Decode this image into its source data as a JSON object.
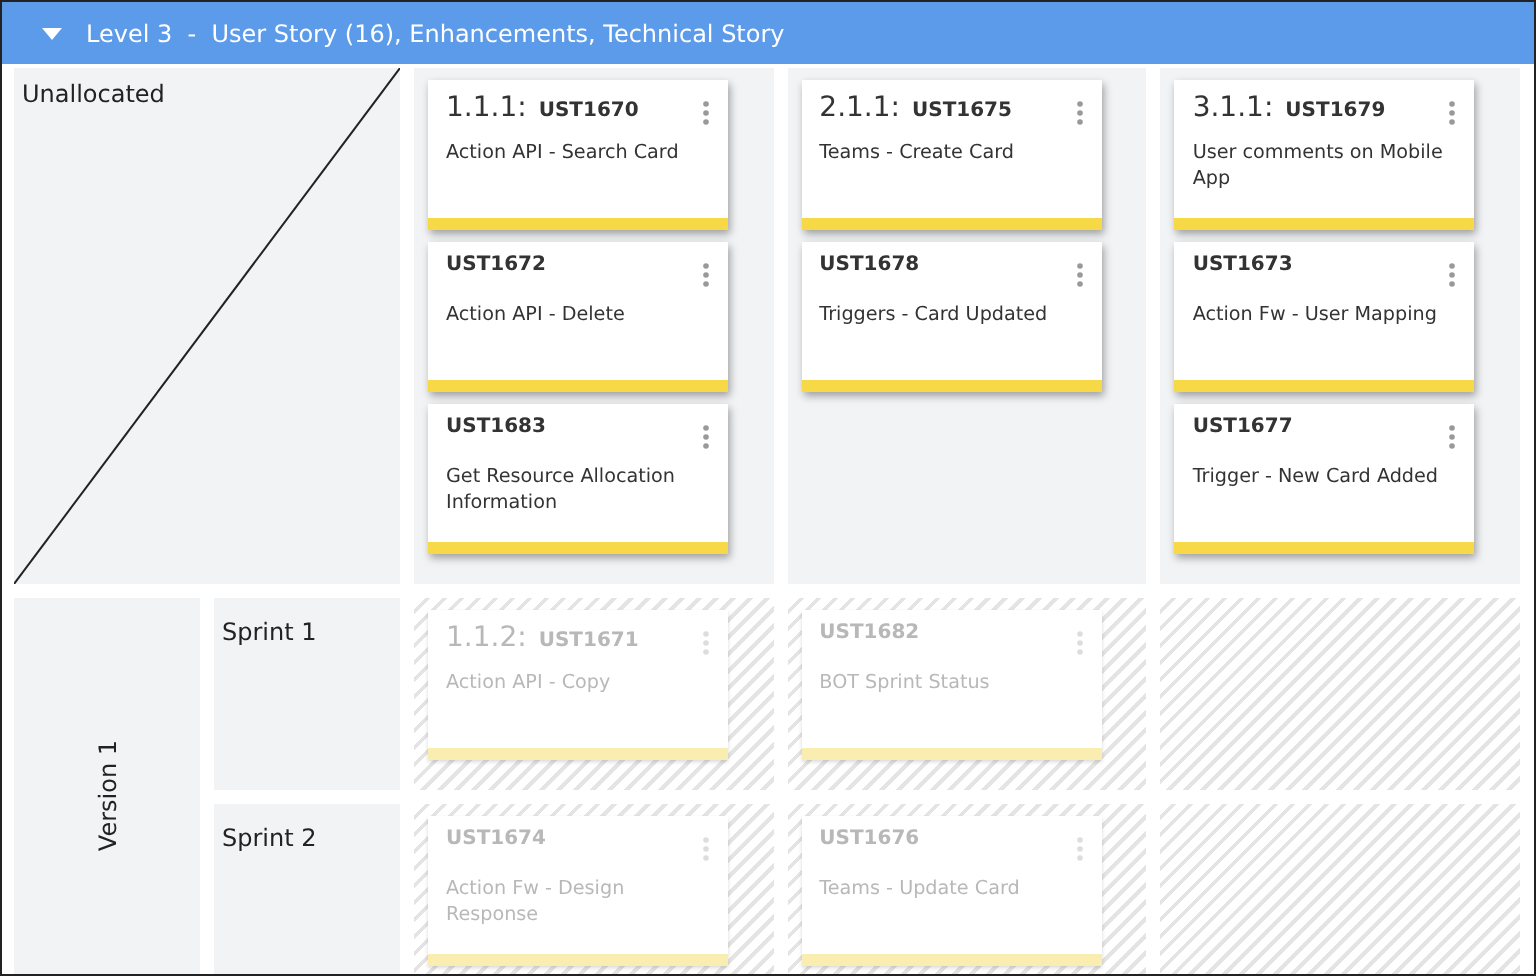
{
  "header": {
    "expanded": true,
    "title": "Level 3  -  User Story (16), Enhancements, Technical Story"
  },
  "unallocated": {
    "label": "Unallocated",
    "columns": [
      [
        {
          "number": "1.1.1:",
          "id": "UST1670",
          "title": "Action API - Search Card"
        },
        {
          "id": "UST1672",
          "title": "Action API - Delete"
        },
        {
          "id": "UST1683",
          "title": "Get Resource Allocation Information"
        }
      ],
      [
        {
          "number": "2.1.1:",
          "id": "UST1675",
          "title": "Teams - Create Card"
        },
        {
          "id": "UST1678",
          "title": "Triggers - Card Updated"
        }
      ],
      [
        {
          "number": "3.1.1:",
          "id": "UST1679",
          "title": "User comments on Mobile App"
        },
        {
          "id": "UST1673",
          "title": "Action Fw - User Mapping"
        },
        {
          "id": "UST1677",
          "title": "Trigger - New Card Added"
        }
      ]
    ]
  },
  "versions": [
    {
      "label": "Version 1",
      "sprints": [
        {
          "label": "Sprint 1",
          "disabled": true,
          "columns": [
            [
              {
                "number": "1.1.2:",
                "id": "UST1671",
                "title": "Action API - Copy"
              }
            ],
            [
              {
                "id": "UST1682",
                "title": "BOT Sprint Status"
              }
            ],
            []
          ]
        },
        {
          "label": "Sprint 2",
          "disabled": true,
          "columns": [
            [
              {
                "id": "UST1674",
                "title": "Action Fw - Design Response"
              }
            ],
            [
              {
                "id": "UST1676",
                "title": "Teams - Update Card"
              }
            ],
            []
          ]
        }
      ]
    }
  ]
}
